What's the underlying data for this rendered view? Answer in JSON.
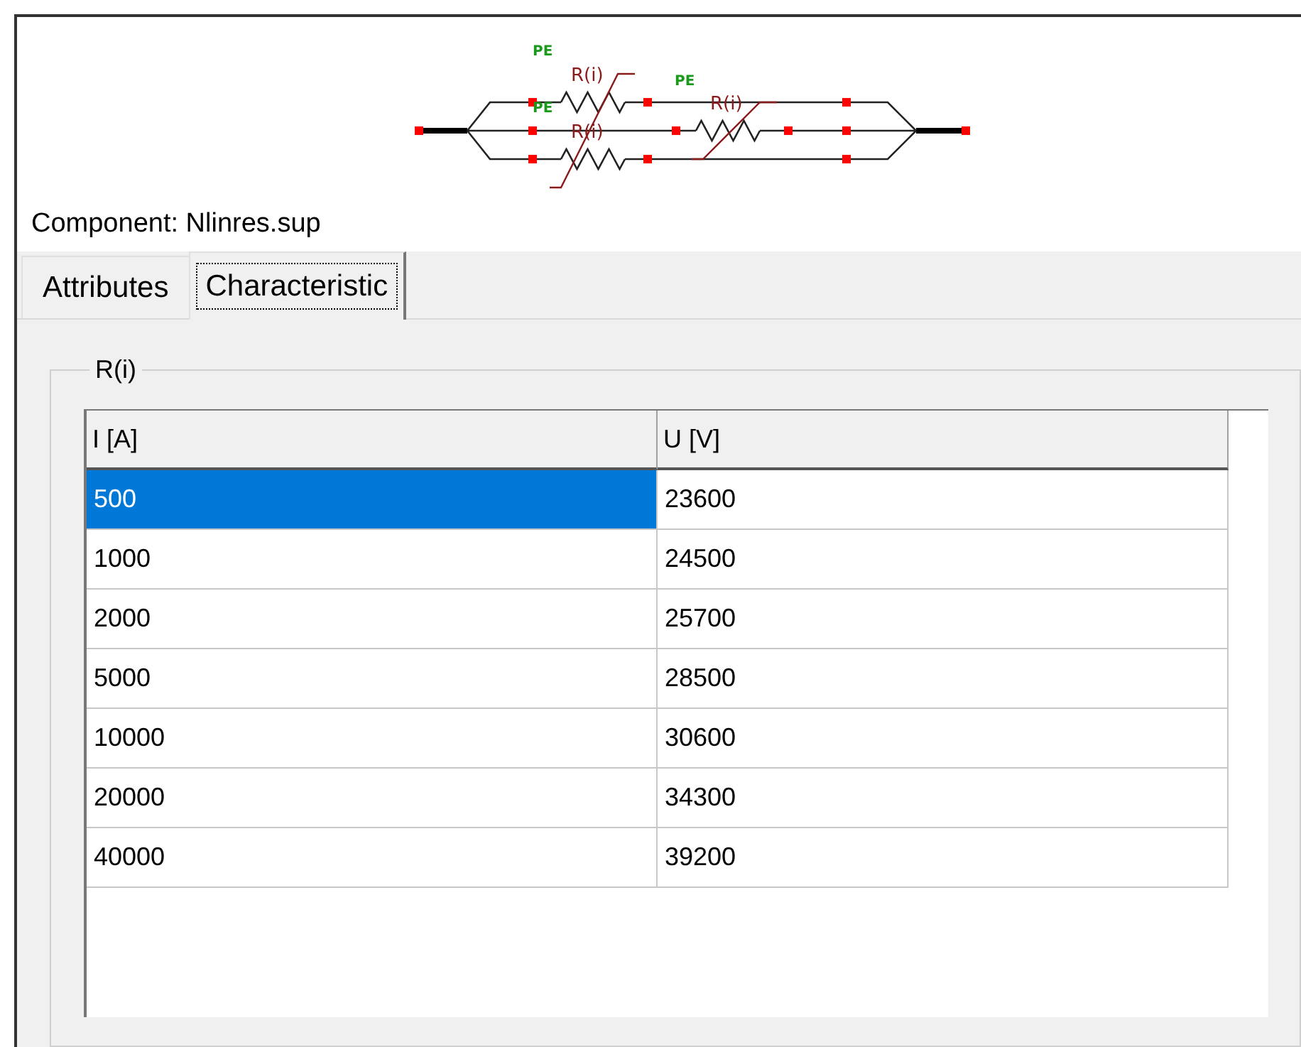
{
  "diagram": {
    "labels": [
      {
        "kind": "pe",
        "text": "PE"
      },
      {
        "kind": "resistor",
        "text": "R(i)"
      },
      {
        "kind": "pe",
        "text": "PE"
      },
      {
        "kind": "pe",
        "text": "PE"
      },
      {
        "kind": "resistor",
        "text": "R(i)"
      },
      {
        "kind": "resistor",
        "text": "R(i)"
      }
    ]
  },
  "component_label": "Component: Nlinres.sup",
  "tabs": [
    {
      "label": "Attributes",
      "selected": false
    },
    {
      "label": "Characteristic",
      "selected": true
    }
  ],
  "group": {
    "title": "R(i)"
  },
  "table": {
    "columns": [
      "I [A]",
      "U [V]"
    ],
    "rows": [
      {
        "cells": [
          "500",
          "23600"
        ],
        "selected": true
      },
      {
        "cells": [
          "1000",
          "24500"
        ],
        "selected": false
      },
      {
        "cells": [
          "2000",
          "25700"
        ],
        "selected": false
      },
      {
        "cells": [
          "5000",
          "28500"
        ],
        "selected": false
      },
      {
        "cells": [
          "10000",
          "30600"
        ],
        "selected": false
      },
      {
        "cells": [
          "20000",
          "34300"
        ],
        "selected": false
      },
      {
        "cells": [
          "40000",
          "39200"
        ],
        "selected": false
      }
    ]
  }
}
